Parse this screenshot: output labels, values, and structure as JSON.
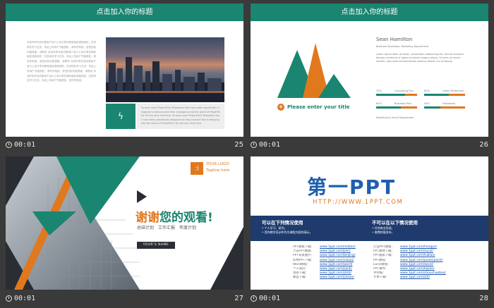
{
  "slides": {
    "s25": {
      "title": "点击加入你的标题",
      "left_text": "本站所有作品均是用户自行上传分享并拥有版权或使用权，仅供网友学习交流，未经上传用户书面授权，请勿作他用。若您的权利被侵害，请联系 本站所有作品均是用户自行上传分享并拥有版权或使用权，仅供网友学习交流，未经上传用户书面授权，请勿作他用。若您的权利被侵害，请联系 本站所有作品均是用户自行上传分享并拥有版权或使用权，仅供网友学习交流，未经上传用户书面授权，请勿作他用。若您的权利被侵害，请联系 本站所有作品均是用户自行上传分享并拥有版权或使用权，仅供网友学习交流，未经上传用户书面授权，请勿作他用。",
      "caption_text": "To save more PowerPoint Templates that have been specifically designed to help anyone that is stepping into the world of PowerPoint for the very first time. To save more PowerPoint Templates that have been specifically designed to help anyone that is stepping into the world of PowerPoint for the very first time.",
      "time": "00:01",
      "number": "25"
    },
    "s26": {
      "title": "点击加入你的标题",
      "name": "Sean Hamilton",
      "role": "Business Developer, Marketing Department",
      "body": "Lorem ipsum dolor sit amet, consectetur adipisicing elit, sed do eiusmod tempor incididunt ut labore et dolore magna aliqua. Ut enim ad minim veniam, quis nostrud exercitation ullamco laboris nisi ut aliquip.",
      "prompt": "Please enter your title",
      "bars": [
        {
          "label": "70%",
          "name": "Consulting Fee",
          "fill": 0.7
        },
        {
          "label": "60%",
          "name": "Listen Protection",
          "fill": 0.6
        },
        {
          "label": "60%",
          "name": "Business Plan",
          "fill": 0.6
        },
        {
          "label": "40%",
          "name": "Handwork",
          "fill": 0.4
        }
      ],
      "bottom": "Marketing & Social Department",
      "time": "00:01",
      "number": "26"
    },
    "s27": {
      "logo_line1": "YOUR LOGO",
      "logo_line2": "Tagline here",
      "thanks_part1": "谢谢",
      "thanks_part2": "您的观看!",
      "subtitle": "总结计划　工作汇报　年度计划",
      "name_box": "YOUR'S NAME",
      "time": "00:01",
      "number": "27"
    },
    "s28": {
      "logo_cn": "第一PPT",
      "url": "HTTP://WWW.1PPT.COM",
      "left_title": "可以在下列情况使用",
      "left_items": [
        "个人学习、研究。",
        "用作教学培训中作为课程内容的演示。"
      ],
      "right_title": "不可以在以下情况使用",
      "right_items": [
        "任何商业用途。",
        "收费转载发布。"
      ],
      "links_left": [
        {
          "label": "PPT模板下载：",
          "url": "www.1ppt.com/moban/"
        },
        {
          "label": "节日PPT模板：",
          "url": "www.1ppt.com/jieri/"
        },
        {
          "label": "PPT背景图片：",
          "url": "www.1ppt.com/beijing/"
        },
        {
          "label": "优秀PPT下载：",
          "url": "www.1ppt.com/xiazai/"
        },
        {
          "label": "Word教程：",
          "url": "www.1ppt.com/word/"
        },
        {
          "label": "个人简历：",
          "url": "www.1ppt.com/jianli/"
        },
        {
          "label": "试卷下载：",
          "url": "www.1ppt.com/shiti/"
        },
        {
          "label": "教案下载：",
          "url": "www.1ppt.com/jiaoan/"
        }
      ],
      "links_right": [
        {
          "label": "行业PPT模板：",
          "url": "www.1ppt.com/hangye/"
        },
        {
          "label": "PPT素材下载：",
          "url": "www.1ppt.com/sucai/"
        },
        {
          "label": "PPT图表下载：",
          "url": "www.1ppt.com/tubiao/"
        },
        {
          "label": "PPT教程：",
          "url": "www.1ppt.com/powerpoint/"
        },
        {
          "label": "Excel教程：",
          "url": "www.1ppt.com/excel/"
        },
        {
          "label": "PPT课件：",
          "url": "www.1ppt.com/kejian/"
        },
        {
          "label": "手抄报：",
          "url": "www.1ppt.com/shouchaobao/"
        },
        {
          "label": "字体下载：",
          "url": "www.1ppt.com/ziti/"
        }
      ],
      "time": "00:01",
      "number": "28"
    }
  },
  "colors": {
    "teal": "#1a8570",
    "orange": "#e0781e",
    "navy": "#1f3b6e",
    "dark": "#2a2d34"
  }
}
